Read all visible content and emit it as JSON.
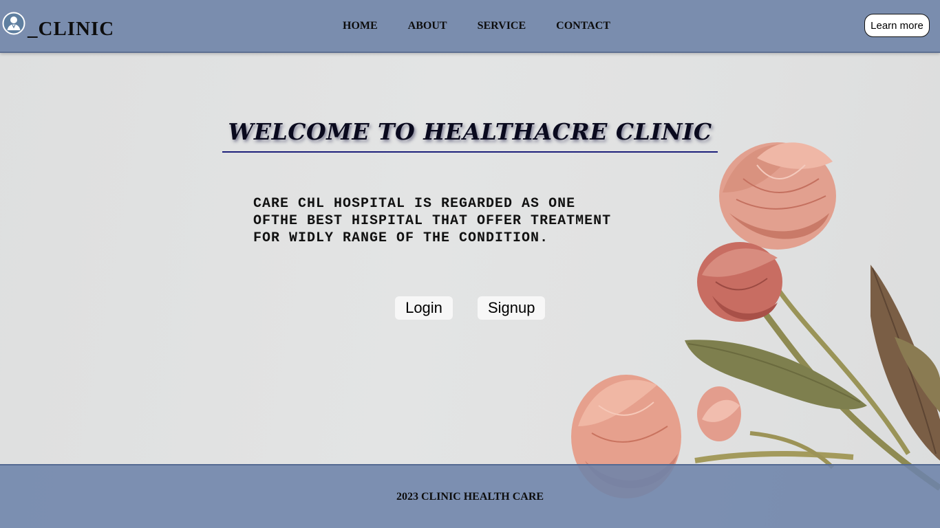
{
  "header": {
    "brand": "_CLINIC",
    "logo_icon": "doctor-avatar-icon",
    "nav": [
      "HOME",
      "ABOUT",
      "SERVICE",
      "CONTACT"
    ],
    "cta_label": "Learn more"
  },
  "hero": {
    "title": "WELCOME TO HEALTHACRE CLINIC",
    "lines": [
      "CARE CHL HOSPITAL IS REGARDED AS ONE",
      "OFTHE BEST HISPITAL THAT OFFER TREATMENT",
      "FOR WIDLY RANGE OF THE CONDITION."
    ],
    "login_label": "Login",
    "signup_label": "Signup"
  },
  "footer": {
    "text": "2023 CLINIC HEALTH CARE"
  },
  "colors": {
    "header_bg": "#7a8dae",
    "title_rule": "#1c1f7a",
    "page_bg": "#e1e2e2"
  }
}
